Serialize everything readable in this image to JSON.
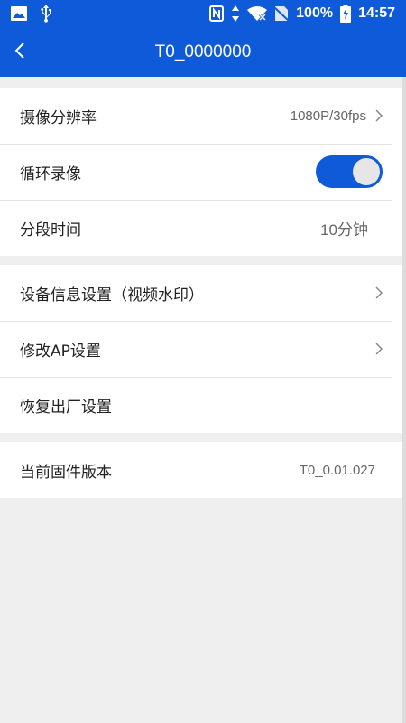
{
  "status_bar": {
    "battery": "100%",
    "time": "14:57"
  },
  "header": {
    "title": "T0_0000000"
  },
  "sections": [
    {
      "rows": [
        {
          "label": "摄像分辨率",
          "value": "1080P/30fps"
        },
        {
          "label": "循环录像",
          "toggle_on": true
        },
        {
          "label": "分段时间",
          "value": "10分钟"
        }
      ]
    },
    {
      "rows": [
        {
          "label": "设备信息设置（视频水印）"
        },
        {
          "label": "修改AP设置"
        },
        {
          "label": "恢复出厂设置"
        }
      ]
    },
    {
      "rows": [
        {
          "label": "当前固件版本",
          "value": "T0_0.01.027"
        }
      ]
    }
  ],
  "colors": {
    "accent": "#0f5ad8",
    "background": "#efefef"
  }
}
